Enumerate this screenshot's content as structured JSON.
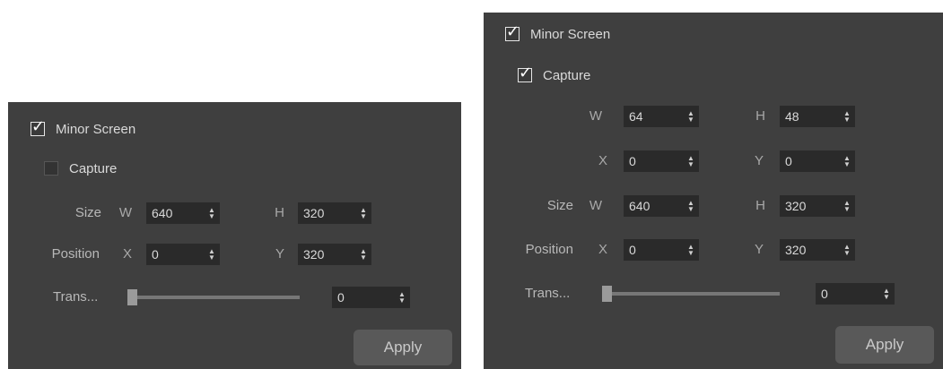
{
  "left_panel": {
    "minor_screen": {
      "label": "Minor Screen",
      "checked": true
    },
    "capture": {
      "label": "Capture",
      "checked": false
    },
    "size": {
      "label": "Size",
      "w_label": "W",
      "w_value": "640",
      "h_label": "H",
      "h_value": "320"
    },
    "position": {
      "label": "Position",
      "x_label": "X",
      "x_value": "0",
      "y_label": "Y",
      "y_value": "320"
    },
    "transparency": {
      "label": "Trans...",
      "value": "0",
      "slider_level": 0.0
    },
    "apply_label": "Apply"
  },
  "right_panel": {
    "minor_screen": {
      "label": "Minor Screen",
      "checked": true
    },
    "capture": {
      "label": "Capture",
      "checked": true,
      "w_label": "W",
      "w_value": "64",
      "h_label": "H",
      "h_value": "48",
      "x_label": "X",
      "x_value": "0",
      "y_label": "Y",
      "y_value": "0"
    },
    "size": {
      "label": "Size",
      "w_label": "W",
      "w_value": "640",
      "h_label": "H",
      "h_value": "320"
    },
    "position": {
      "label": "Position",
      "x_label": "X",
      "x_value": "0",
      "y_label": "Y",
      "y_value": "320"
    },
    "transparency": {
      "label": "Trans...",
      "value": "0",
      "slider_level": 0.0
    },
    "apply_label": "Apply"
  },
  "icons": {
    "check": "✓",
    "spin_up": "▲",
    "spin_down": "▼"
  },
  "colors": {
    "panel_bg": "#3f3f3f",
    "field_bg": "#2a2a2a",
    "button_bg": "#595959"
  }
}
